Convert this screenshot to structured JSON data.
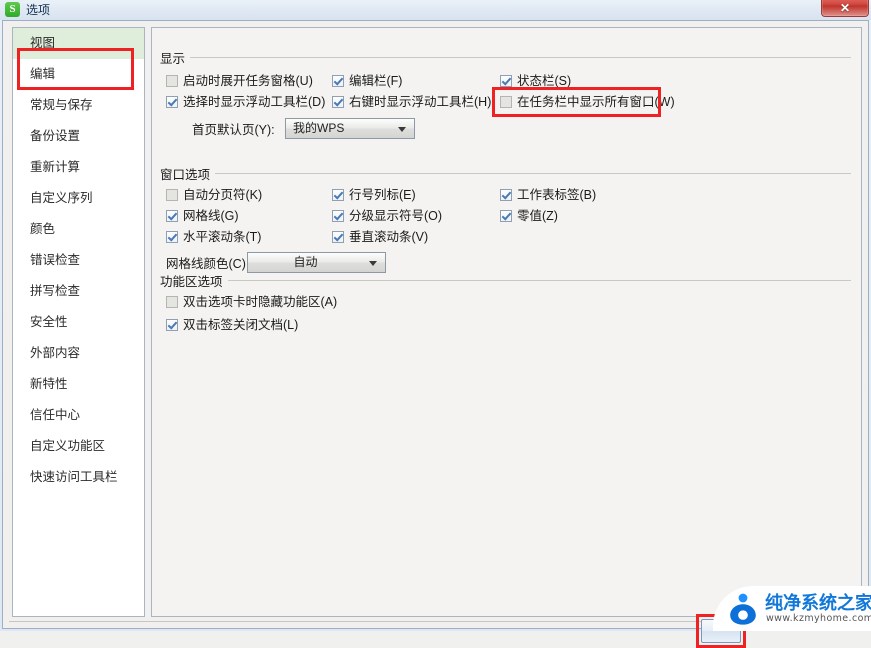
{
  "window": {
    "title": "选项",
    "app_icon": "S",
    "close_label": "✕"
  },
  "sidebar": {
    "items": [
      {
        "label": "视图",
        "selected": true
      },
      {
        "label": "编辑",
        "selected": false
      },
      {
        "label": "常规与保存",
        "selected": false
      },
      {
        "label": "备份设置",
        "selected": false
      },
      {
        "label": "重新计算",
        "selected": false
      },
      {
        "label": "自定义序列",
        "selected": false
      },
      {
        "label": "颜色",
        "selected": false
      },
      {
        "label": "错误检查",
        "selected": false
      },
      {
        "label": "拼写检查",
        "selected": false
      },
      {
        "label": "安全性",
        "selected": false
      },
      {
        "label": "外部内容",
        "selected": false
      },
      {
        "label": "新特性",
        "selected": false
      },
      {
        "label": "信任中心",
        "selected": false
      },
      {
        "label": "自定义功能区",
        "selected": false
      },
      {
        "label": "快速访问工具栏",
        "selected": false
      }
    ]
  },
  "main": {
    "groups": [
      {
        "title": "显示",
        "checkboxes": [
          {
            "label": "启动时展开任务窗格(U)",
            "checked": false
          },
          {
            "label": "编辑栏(F)",
            "checked": true
          },
          {
            "label": "状态栏(S)",
            "checked": true
          },
          {
            "label": "选择时显示浮动工具栏(D)",
            "checked": true
          },
          {
            "label": "右键时显示浮动工具栏(H)",
            "checked": true
          },
          {
            "label": "在任务栏中显示所有窗口(W)",
            "checked": false
          }
        ],
        "field": {
          "label": "首页默认页(Y):",
          "value": "我的WPS"
        }
      },
      {
        "title": "窗口选项",
        "checkboxes": [
          {
            "label": "自动分页符(K)",
            "checked": false
          },
          {
            "label": "行号列标(E)",
            "checked": true
          },
          {
            "label": "工作表标签(B)",
            "checked": true
          },
          {
            "label": "网格线(G)",
            "checked": true
          },
          {
            "label": "分级显示符号(O)",
            "checked": true
          },
          {
            "label": "零值(Z)",
            "checked": true
          },
          {
            "label": "水平滚动条(T)",
            "checked": true
          },
          {
            "label": "垂直滚动条(V)",
            "checked": true
          }
        ],
        "field": {
          "label": "网格线颜色(C):",
          "value": "自动"
        }
      },
      {
        "title": "功能区选项",
        "checkboxes": [
          {
            "label": "双击选项卡时隐藏功能区(A)",
            "checked": false
          },
          {
            "label": "双击标签关闭文档(L)",
            "checked": true
          }
        ]
      }
    ]
  },
  "annotations": {
    "accent_color": "#ee2222",
    "selected_bg": "#dfeeda"
  },
  "watermark": {
    "title": "纯净系统之家",
    "url": "www.kzmyhome.com"
  }
}
